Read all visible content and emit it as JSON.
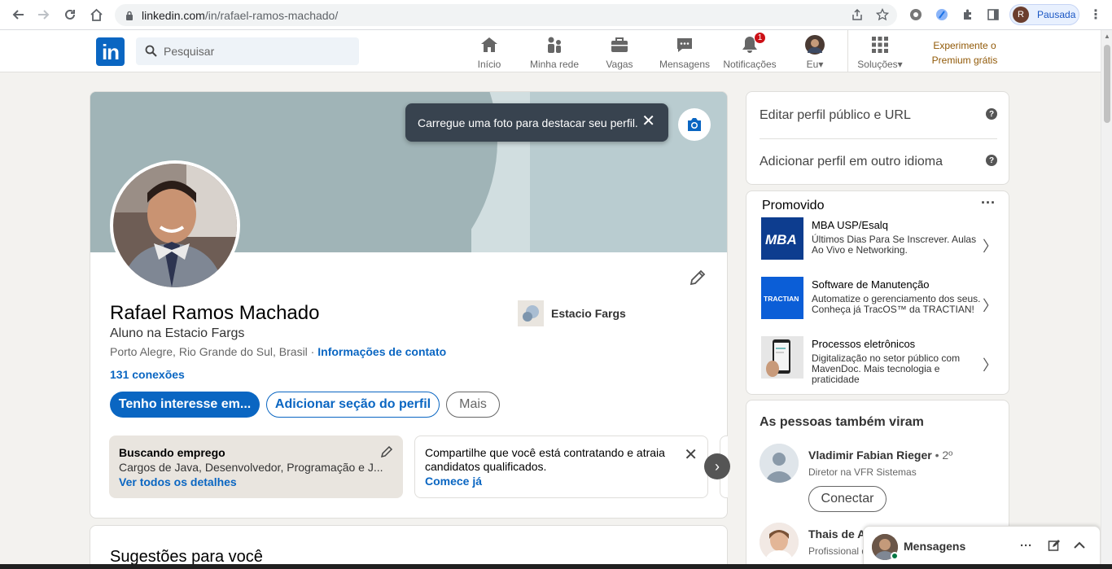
{
  "browser": {
    "url_host": "linkedin.com",
    "url_path": "/in/rafael-ramos-machado/",
    "profile_initial": "R",
    "profile_status": "Pausada"
  },
  "nav": {
    "search_placeholder": "Pesquisar",
    "items": [
      {
        "label": "Início",
        "icon": "home-icon"
      },
      {
        "label": "Minha rede",
        "icon": "network-icon"
      },
      {
        "label": "Vagas",
        "icon": "briefcase-icon"
      },
      {
        "label": "Mensagens",
        "icon": "messaging-icon"
      },
      {
        "label": "Notificações",
        "icon": "bell-icon",
        "badge": "1"
      },
      {
        "label": "Eu",
        "icon": "me-avatar"
      }
    ],
    "solutions_label": "Soluções",
    "premium_line1": "Experimente o",
    "premium_line2": "Premium grátis"
  },
  "profile": {
    "tooltip": "Carregue uma foto para destacar seu perfil.",
    "name": "Rafael Ramos Machado",
    "headline": "Aluno na Estacio Fargs",
    "location": "Porto Alegre, Rio Grande do Sul, Brasil",
    "location_sep": " · ",
    "contact_link": "Informações de contato",
    "connections": "131 conexões",
    "org_name": "Estacio Fargs",
    "btn_primary": "Tenho interesse em...",
    "btn_secondary": "Adicionar seção do perfil",
    "btn_more": "Mais",
    "otw_title": "Buscando emprego",
    "otw_desc": "Cargos de Java, Desenvolvedor, Programação e J...",
    "otw_link": "Ver todos os detalhes",
    "hiring_text": "Compartilhe que você está contratando e atraia candidatos qualificados.",
    "hiring_link": "Comece já",
    "suggestions_title": "Sugestões para você"
  },
  "sidebar": {
    "edit_public": "Editar perfil público e URL",
    "add_language": "Adicionar perfil em outro idioma",
    "promoted_title": "Promovido",
    "ads": [
      {
        "title": "MBA USP/Esalq",
        "desc": "Últimos Dias Para Se Inscrever. Aulas Ao Vivo e Networking.",
        "logo_text": "MBA"
      },
      {
        "title": "Software de Manutenção",
        "desc": "Automatize o gerenciamento dos seus. Conheça já TracOS™ da TRACTIAN!",
        "logo_text": "TRACTIAN"
      },
      {
        "title": "Processos eletrônicos",
        "desc": "Digitalização no setor público com MavenDoc. Mais tecnologia e praticidade"
      }
    ],
    "viewed_title": "As pessoas também viram",
    "people": [
      {
        "name": "Vladimir Fabian Rieger",
        "degree": " • 2º",
        "desc": "Diretor na VFR Sistemas"
      },
      {
        "name": "Thais de Az",
        "desc": "Profissional d"
      }
    ],
    "connect_label": "Conectar"
  },
  "messaging": {
    "title": "Mensagens"
  },
  "colors": {
    "linkedin_blue": "#0a66c2",
    "premium_gold": "#915907",
    "badge_red": "#cc1016"
  }
}
